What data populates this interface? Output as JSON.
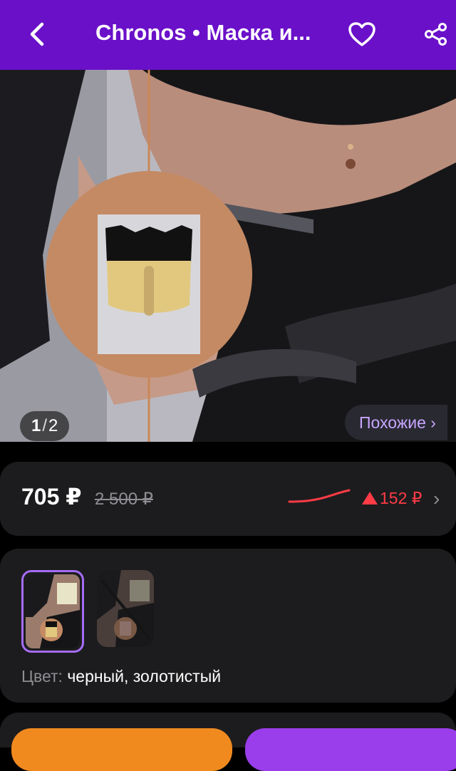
{
  "header": {
    "title": "Chronos • Маска и...",
    "back_icon": "chevron-left-icon",
    "favorite_icon": "heart-icon",
    "share_icon": "share-icon",
    "bg_color": "#6a10c9"
  },
  "gallery": {
    "current": "1",
    "total": "2",
    "similar_label": "Похожие ›"
  },
  "price": {
    "current": "705 ₽",
    "old": "2 500 ₽",
    "change": "152 ₽",
    "change_color": "#ff3b46"
  },
  "color": {
    "label_key": "Цвет:",
    "label_value": " черный, золотистый",
    "selected_border": "#a56cf6"
  }
}
